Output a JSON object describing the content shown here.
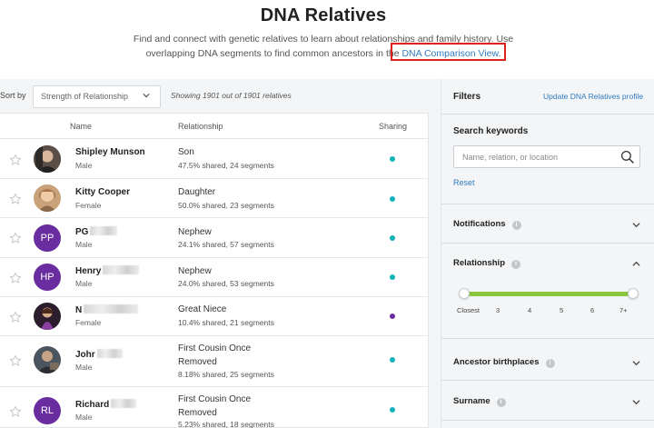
{
  "header": {
    "title": "DNA Relatives",
    "intro_line1": "Find and connect with genetic relatives to learn about relationships and family history. Use",
    "intro_line2_prefix": "overlapping DNA segments to find common ancestors in the ",
    "intro_link": "DNA Comparison View",
    "intro_line2_suffix": "."
  },
  "toolbar": {
    "sort_label": "Sort by",
    "sort_value": "Strength of Relationship",
    "showing": "Showing 1901 out of 1901 relatives"
  },
  "table": {
    "columns": {
      "name": "Name",
      "relationship": "Relationship",
      "sharing": "Sharing"
    },
    "rows": [
      {
        "name": "Shipley Munson",
        "sex": "Male",
        "relationship": "Son",
        "relationship_line2": "",
        "shared": "47.5% shared, 24 segments",
        "avatar": "photo",
        "sharing_color": "#10b3b8"
      },
      {
        "name": "Kitty Cooper",
        "sex": "Female",
        "relationship": "Daughter",
        "relationship_line2": "",
        "shared": "50.0% shared, 23 segments",
        "avatar": "photo",
        "sharing_color": "#10b3b8"
      },
      {
        "name": "PG",
        "sex": "Male",
        "relationship": "Nephew",
        "relationship_line2": "",
        "shared": "24.1% shared, 57 segments",
        "avatar": "initials",
        "initials": "PP",
        "sharing_color": "#10b3b8"
      },
      {
        "name": "Henry",
        "sex": "Male",
        "relationship": "Nephew",
        "relationship_line2": "",
        "shared": "24.0% shared, 53 segments",
        "avatar": "initials",
        "initials": "HP",
        "sharing_color": "#10b3b8"
      },
      {
        "name": "N",
        "sex": "Female",
        "relationship": "Great Niece",
        "relationship_line2": "",
        "shared": "10.4% shared, 21 segments",
        "avatar": "photo",
        "sharing_color": "#6a2d9f"
      },
      {
        "name": "Johr",
        "sex": "Male",
        "relationship": "First Cousin Once",
        "relationship_line2": "Removed",
        "shared": "8.18% shared, 25 segments",
        "avatar": "photo",
        "sharing_color": "#10b3b8"
      },
      {
        "name": "Richard",
        "sex": "Male",
        "relationship": "First Cousin Once",
        "relationship_line2": "Removed",
        "shared": "5.23% shared, 18 segments",
        "avatar": "initials",
        "initials": "RL",
        "sharing_color": "#10b3b8"
      }
    ]
  },
  "filters": {
    "title": "Filters",
    "update_link": "Update DNA Relatives profile",
    "search_label": "Search keywords",
    "search_placeholder": "Name, relation, or location",
    "reset": "Reset",
    "sections": {
      "notifications": "Notifications",
      "relationship": "Relationship",
      "ancestor_birthplaces": "Ancestor birthplaces",
      "surname": "Surname"
    },
    "slider_ticks": [
      "Closest",
      "3",
      "4",
      "5",
      "6",
      "7+"
    ],
    "slider_accent": "#8cc63f"
  },
  "colors": {
    "link": "#2f7bbf",
    "highlight": "#e0201b",
    "avatar_purple": "#6a2d9f",
    "sharing_teal": "#10b3b8"
  }
}
